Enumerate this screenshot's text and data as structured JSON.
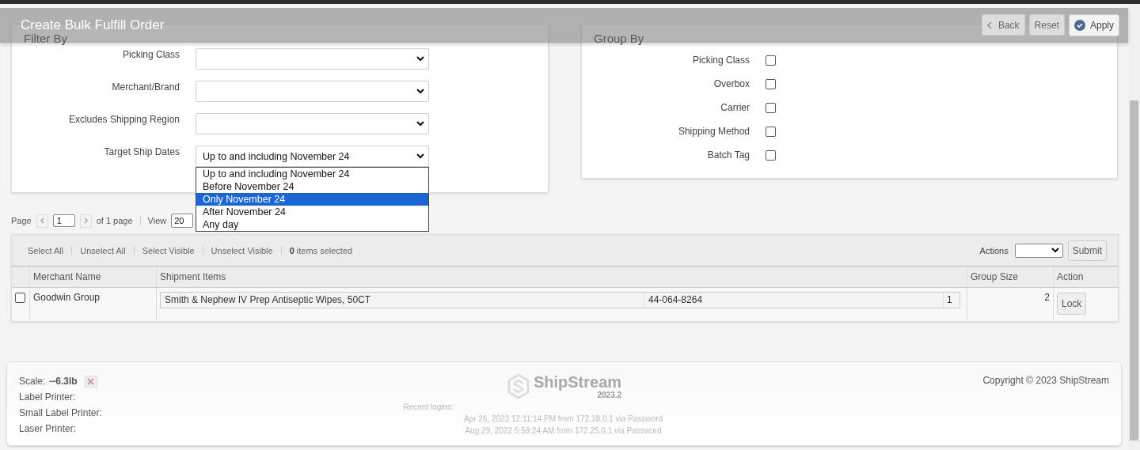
{
  "header": {
    "title": "Create Bulk Fulfill Order",
    "buttons": [
      {
        "kind": "back",
        "label": "Back"
      },
      {
        "kind": "plain",
        "label": "Reset"
      },
      {
        "kind": "apply",
        "label": "Apply"
      }
    ]
  },
  "filter_by": {
    "title": "Filter By",
    "fields": [
      {
        "label": "Picking Class"
      },
      {
        "label": "Merchant/Brand"
      },
      {
        "label": "Excludes Shipping Region"
      },
      {
        "label": "Target Ship Dates",
        "value": "Up to and including November 24",
        "open": true
      }
    ],
    "dropdown_options": [
      {
        "label": "Up to and including November 24",
        "selected": false
      },
      {
        "label": "Before November 24",
        "selected": false
      },
      {
        "label": "Only November 24",
        "selected": true
      },
      {
        "label": "After November 24",
        "selected": false
      },
      {
        "label": "Any day",
        "selected": false
      }
    ]
  },
  "group_by": {
    "title": "Group By",
    "options": [
      {
        "label": "Picking Class",
        "checked": false
      },
      {
        "label": "Overbox",
        "checked": false
      },
      {
        "label": "Carrier",
        "checked": false
      },
      {
        "label": "Shipping Method",
        "checked": false
      },
      {
        "label": "Batch Tag",
        "checked": false
      }
    ]
  },
  "pager": {
    "page_label": "Page",
    "page": "1",
    "of_pages": "of 1 page",
    "view_label": "View",
    "view": "20"
  },
  "grid": {
    "toolbar_links": [
      "Select All",
      "Unselect All",
      "Select Visible",
      "Unselect Visible"
    ],
    "selected_count": "0",
    "selected_text": "items selected",
    "actions_label": "Actions",
    "submit": "Submit",
    "columns": [
      "Merchant Name",
      "Shipment Items",
      "Group Size",
      "Action"
    ],
    "rows": [
      {
        "checked": false,
        "merchant": "Goodwin Group",
        "item_name": "Smith & Nephew IV Prep Antiseptic Wipes, 50CT",
        "item_sku": "44-064-8264",
        "item_qty": "1",
        "group_size": "2",
        "action": "Lock"
      }
    ]
  },
  "footer": {
    "scale_label": "Scale:",
    "scale_value": "--6.3lb",
    "printers": [
      "Label Printer:",
      "Small Label Printer:",
      "Laser Printer:"
    ],
    "logo_text": "ShipStream",
    "version": "2023.2",
    "recent_logins_label": "Recent logins:",
    "logins": [
      "Apr 26, 2023 12:11:14 PM from 172.18.0.1 via Password",
      "Aug 29, 2022 5:59:24 AM from 172.25.0.1 via Password"
    ],
    "copyright": "Copyright © 2023 ShipStream"
  }
}
